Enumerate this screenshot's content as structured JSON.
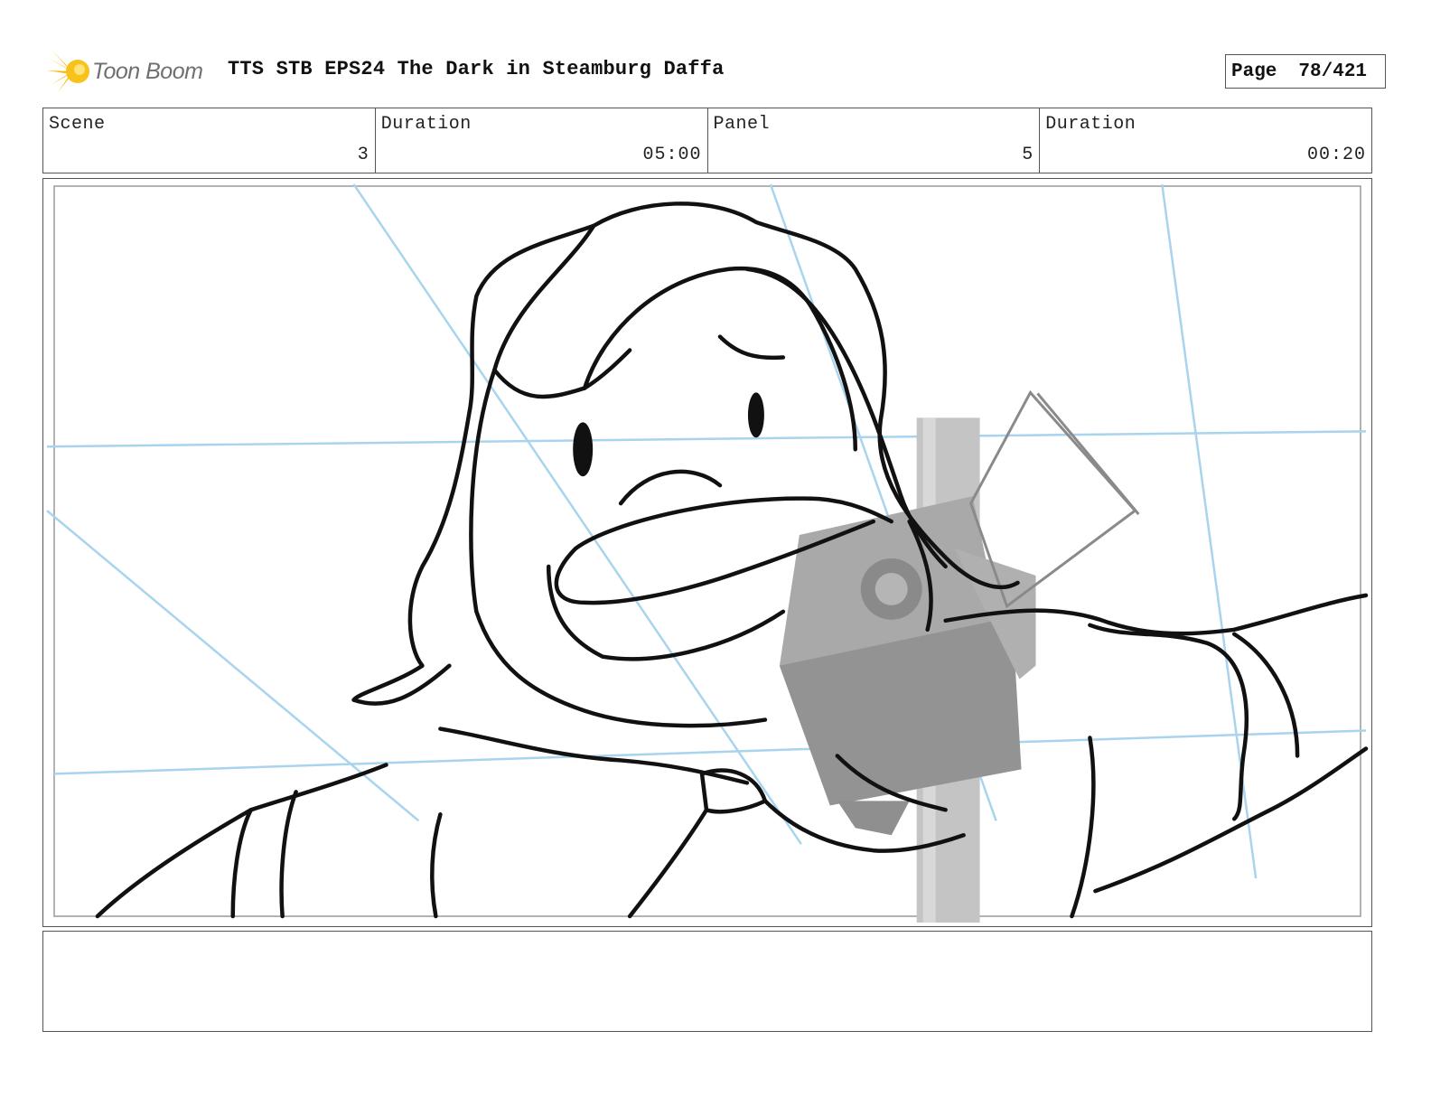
{
  "header": {
    "logo_text": "Toon Boom",
    "title": "TTS STB EPS24 The Dark in Steamburg Daffa",
    "page_label": "Page",
    "page_value": "78/421"
  },
  "info": {
    "scene_label": "Scene",
    "scene_value": "3",
    "scene_duration_label": "Duration",
    "scene_duration_value": "05:00",
    "panel_label": "Panel",
    "panel_value": "5",
    "panel_duration_label": "Duration",
    "panel_duration_value": "00:20"
  },
  "notes": {
    "text": ""
  },
  "colors": {
    "logo_accent": "#f5b800",
    "guide_lines": "#a8d4ee",
    "ink": "#111111",
    "prop_gray": "#a9a9a9"
  }
}
